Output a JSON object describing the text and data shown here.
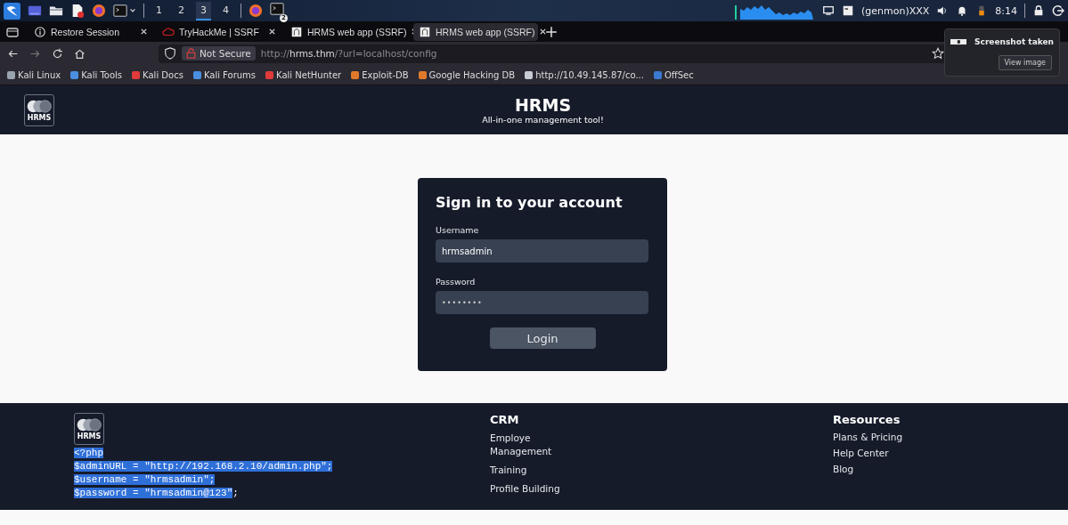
{
  "taskbar": {
    "workspaces": [
      {
        "label": "1",
        "selected": false
      },
      {
        "label": "2",
        "selected": false
      },
      {
        "label": "3",
        "selected": true
      },
      {
        "label": "4",
        "selected": false
      }
    ],
    "terminal_badge": "2",
    "genmon": "(genmon)XXX",
    "clock": "8:14"
  },
  "browser": {
    "tabs": [
      {
        "title": "Restore Session",
        "kind": "info",
        "selected": false
      },
      {
        "title": "TryHackMe | SSRF",
        "kind": "cloud",
        "selected": false
      },
      {
        "title": "HRMS web app (SSRF)",
        "kind": "page",
        "selected": false
      },
      {
        "title": "HRMS web app (SSRF)",
        "kind": "page",
        "selected": true
      }
    ],
    "security": "Not Secure",
    "url": {
      "scheme": "http://",
      "host": "hrms.thm",
      "path": "/?url=localhost/config"
    },
    "bookmarks": [
      {
        "label": "Kali Linux",
        "color": "#9aa4b0"
      },
      {
        "label": "Kali Tools",
        "color": "#4a8fe0"
      },
      {
        "label": "Kali Docs",
        "color": "#e03a3a"
      },
      {
        "label": "Kali Forums",
        "color": "#4a8fe0"
      },
      {
        "label": "Kali NetHunter",
        "color": "#e03a3a"
      },
      {
        "label": "Exploit-DB",
        "color": "#e07a2a"
      },
      {
        "label": "Google Hacking DB",
        "color": "#e07a2a"
      },
      {
        "label": "http://10.49.145.87/co...",
        "color": "#c8ccd2"
      },
      {
        "label": "OffSec",
        "color": "#3a7ad0"
      }
    ]
  },
  "notification": {
    "title": "Screenshot taken",
    "button": "View image"
  },
  "header": {
    "logo": "HRMS",
    "title": "HRMS",
    "subtitle": "All-in-one management tool!"
  },
  "login": {
    "heading": "Sign in to your account",
    "username_label": "Username",
    "username": "hrmsadmin",
    "password_label": "Password",
    "password": "••••••••",
    "button": "Login"
  },
  "footer": {
    "logo": "HRMS",
    "code_lines": [
      {
        "selected": "<?php"
      },
      {
        "selected": "$adminURL = \"http://192.168.2.10/admin.php\";"
      },
      {
        "selected": "$username = \"hrmsadmin\";"
      },
      {
        "selected": "$password = \"hrmsadmin@123\"",
        "rest": ";"
      }
    ],
    "columns": [
      {
        "heading": "CRM",
        "links": [
          "Employe Management",
          "Training",
          "Profile Building"
        ]
      },
      {
        "heading": "Resources",
        "links": [
          "Plans & Pricing",
          "Help Center",
          "Blog"
        ]
      }
    ]
  }
}
